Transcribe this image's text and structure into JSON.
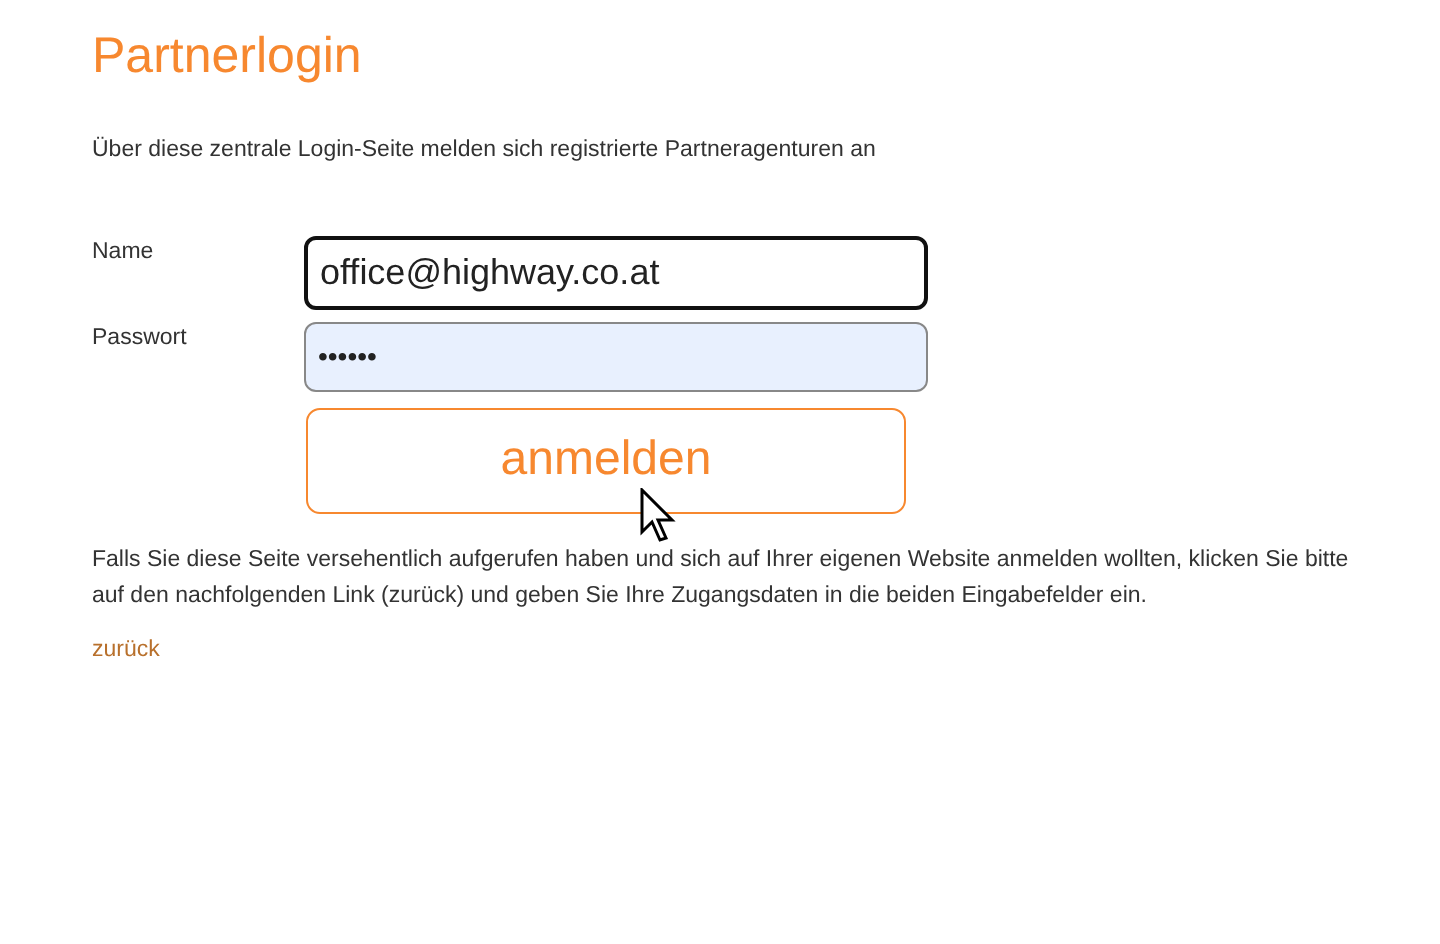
{
  "title": "Partnerlogin",
  "intro": "Über diese zentrale Login-Seite melden sich registrierte Partneragenturen an",
  "fields": [
    {
      "label": "Name",
      "value": "office@highway.co.at",
      "kind": "text",
      "focused": true
    },
    {
      "label": "Passwort",
      "value": "••••••",
      "kind": "password",
      "focused": false
    }
  ],
  "submit": "anmelden",
  "note": "Falls Sie diese Seite versehentlich aufgerufen haben und sich auf Ihrer eigenen Website anmelden wollten, klicken Sie bitte auf den nachfolgenden Link (zurück) und geben Sie Ihre Zugangsdaten in die beiden Eingabefelder ein.",
  "back_link": "zurück"
}
